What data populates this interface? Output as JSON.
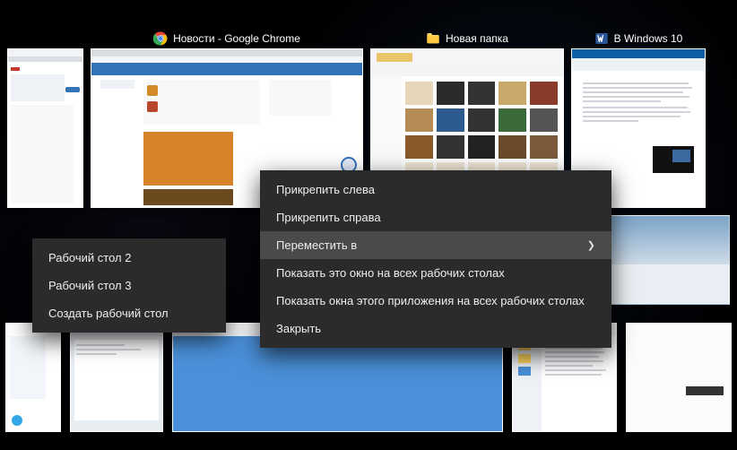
{
  "windows": {
    "chrome": {
      "title": "Новости - Google Chrome"
    },
    "explorer": {
      "title": "Новая папка"
    },
    "word": {
      "title": "В Windows 10"
    }
  },
  "context_menu": {
    "pin_left": "Прикрепить слева",
    "pin_right": "Прикрепить справа",
    "move_to": "Переместить в",
    "show_window_all": "Показать это окно на всех рабочих столах",
    "show_app_all": "Показать окна этого приложения на всех рабочих столах",
    "close": "Закрыть"
  },
  "move_submenu": {
    "desktop2": "Рабочий стол 2",
    "desktop3": "Рабочий стол 3",
    "new_desktop": "Создать рабочий стол"
  }
}
